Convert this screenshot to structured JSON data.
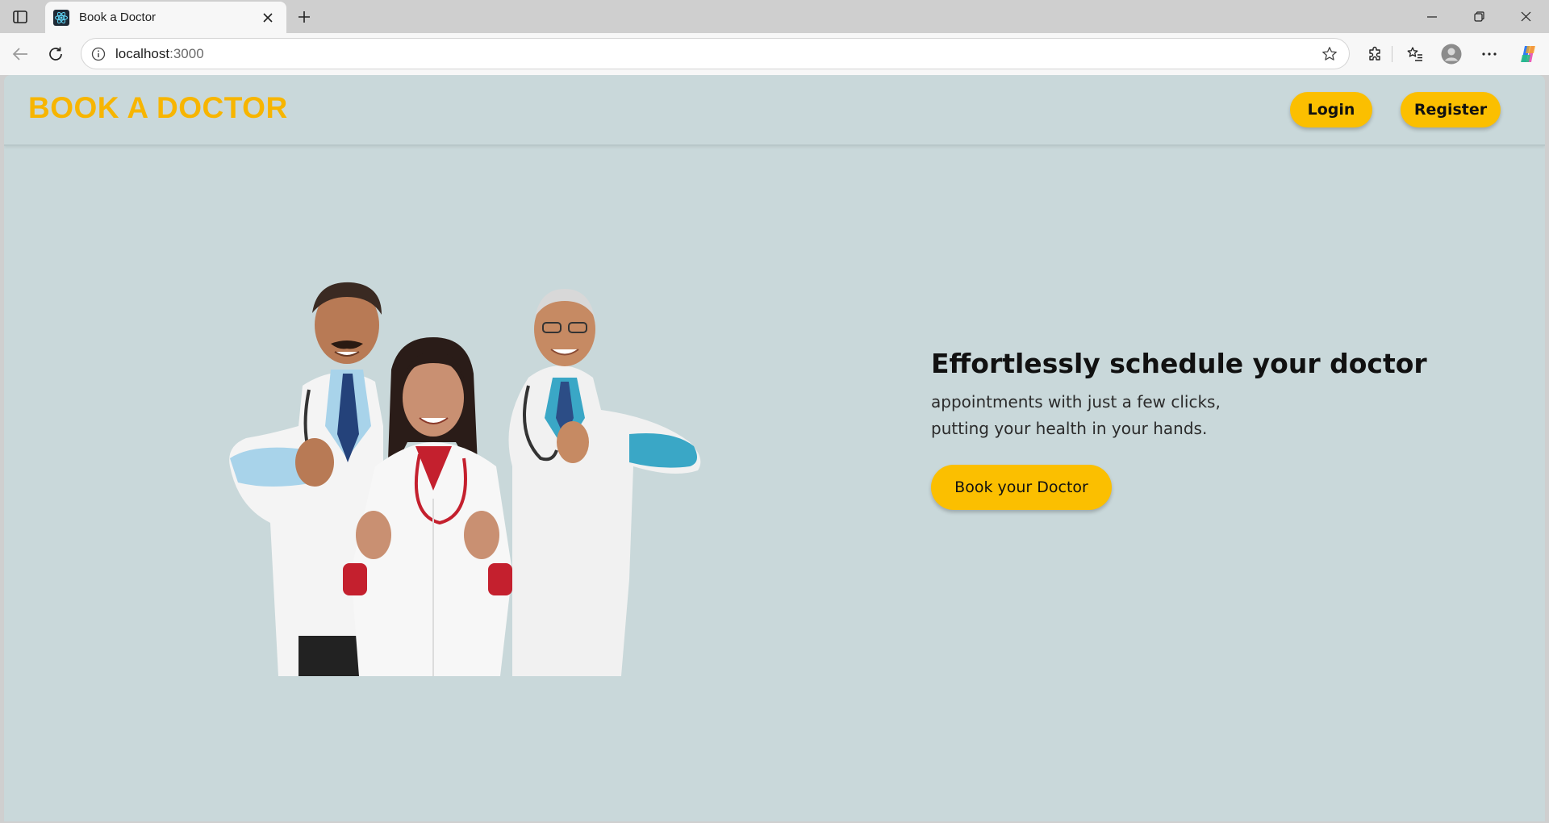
{
  "browser": {
    "tab_title": "Book a Doctor",
    "url_host": "localhost",
    "url_port": ":3000"
  },
  "header": {
    "brand": "BOOK A DOCTOR",
    "login_label": "Login",
    "register_label": "Register"
  },
  "hero": {
    "title": "Effortlessly schedule your doctor",
    "subtitle_line1": "appointments with just a few clicks,",
    "subtitle_line2": "putting your health in your hands.",
    "cta_label": "Book your Doctor"
  },
  "colors": {
    "page_bg": "#c9d8da",
    "accent": "#fbbf00",
    "brand": "#f7b500"
  }
}
